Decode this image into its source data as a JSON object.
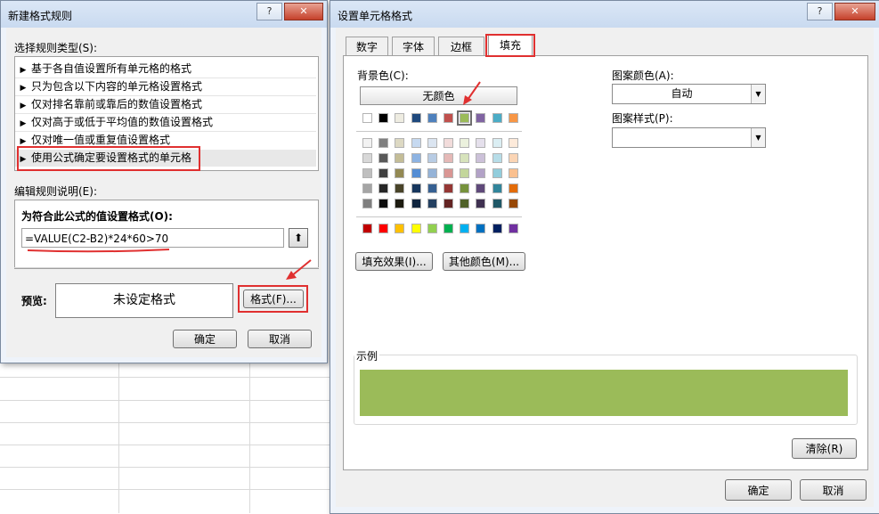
{
  "left_dialog": {
    "title": "新建格式规则",
    "help_glyph": "?",
    "close_glyph": "✕",
    "select_rule_type_label": "选择规则类型(S):",
    "rules": [
      "基于各自值设置所有单元格的格式",
      "只为包含以下内容的单元格设置格式",
      "仅对排名靠前或靠后的数值设置格式",
      "仅对高于或低于平均值的数值设置格式",
      "仅对唯一值或重复值设置格式",
      "使用公式确定要设置格式的单元格"
    ],
    "rule_arrow_glyph": "▶",
    "edit_rule_label": "编辑规则说明(E):",
    "formula_section_label": "为符合此公式的值设置格式(O):",
    "formula_value": "=VALUE(C2-B2)*24*60>70",
    "collapse_glyph": "⬆",
    "preview_label": "预览:",
    "preview_text": "未设定格式",
    "format_button": "格式(F)...",
    "ok_button": "确定",
    "cancel_button": "取消"
  },
  "right_dialog": {
    "title": "设置单元格格式",
    "help_glyph": "?",
    "close_glyph": "✕",
    "tabs": [
      "数字",
      "字体",
      "边框",
      "填充"
    ],
    "active_tab": "填充",
    "background_color_label": "背景色(C):",
    "no_color_button": "无颜色",
    "pattern_color_label": "图案颜色(A):",
    "pattern_color_value": "自动",
    "pattern_style_label": "图案样式(P):",
    "pattern_style_value": "",
    "fill_effects_button": "填充效果(I)...",
    "more_colors_button": "其他颜色(M)...",
    "sample_label": "示例",
    "sample_color": "#9bbb59",
    "clear_button": "清除(R)",
    "ok_button": "确定",
    "cancel_button": "取消",
    "dropdown_glyph": "▼",
    "palette": {
      "theme_top": [
        "#ffffff",
        "#000000",
        "#eeece1",
        "#1f497d",
        "#4f81bd",
        "#c0504d",
        "#9bbb59",
        "#8064a2",
        "#4bacc6",
        "#f79646"
      ],
      "theme_shades": [
        [
          "#f2f2f2",
          "#7f7f7f",
          "#ddd9c3",
          "#c6d9f0",
          "#dbe5f1",
          "#f2dcdb",
          "#ebf1dd",
          "#e5e0ec",
          "#dbeef3",
          "#fdeada"
        ],
        [
          "#d8d8d8",
          "#595959",
          "#c4bd97",
          "#8db3e2",
          "#b8cce4",
          "#e5b9b7",
          "#d7e3bc",
          "#ccc1d9",
          "#b7dde8",
          "#fbd5b5"
        ],
        [
          "#bfbfbf",
          "#3f3f3f",
          "#938953",
          "#548dd4",
          "#95b3d7",
          "#d99694",
          "#c3d69b",
          "#b2a2c7",
          "#92cddc",
          "#fac08f"
        ],
        [
          "#a5a5a5",
          "#262626",
          "#494429",
          "#17365d",
          "#366092",
          "#953734",
          "#76923c",
          "#5f497a",
          "#31859b",
          "#e36c09"
        ],
        [
          "#7f7f7f",
          "#0c0c0c",
          "#1d1b10",
          "#0f243e",
          "#244061",
          "#632423",
          "#4f6128",
          "#3f3151",
          "#205867",
          "#974806"
        ]
      ],
      "standard": [
        "#c00000",
        "#ff0000",
        "#ffc000",
        "#ffff00",
        "#92d050",
        "#00b050",
        "#00b0f0",
        "#0070c0",
        "#002060",
        "#7030a0"
      ],
      "selected": "#9bbb59"
    }
  },
  "highlight_color": "#e03030"
}
